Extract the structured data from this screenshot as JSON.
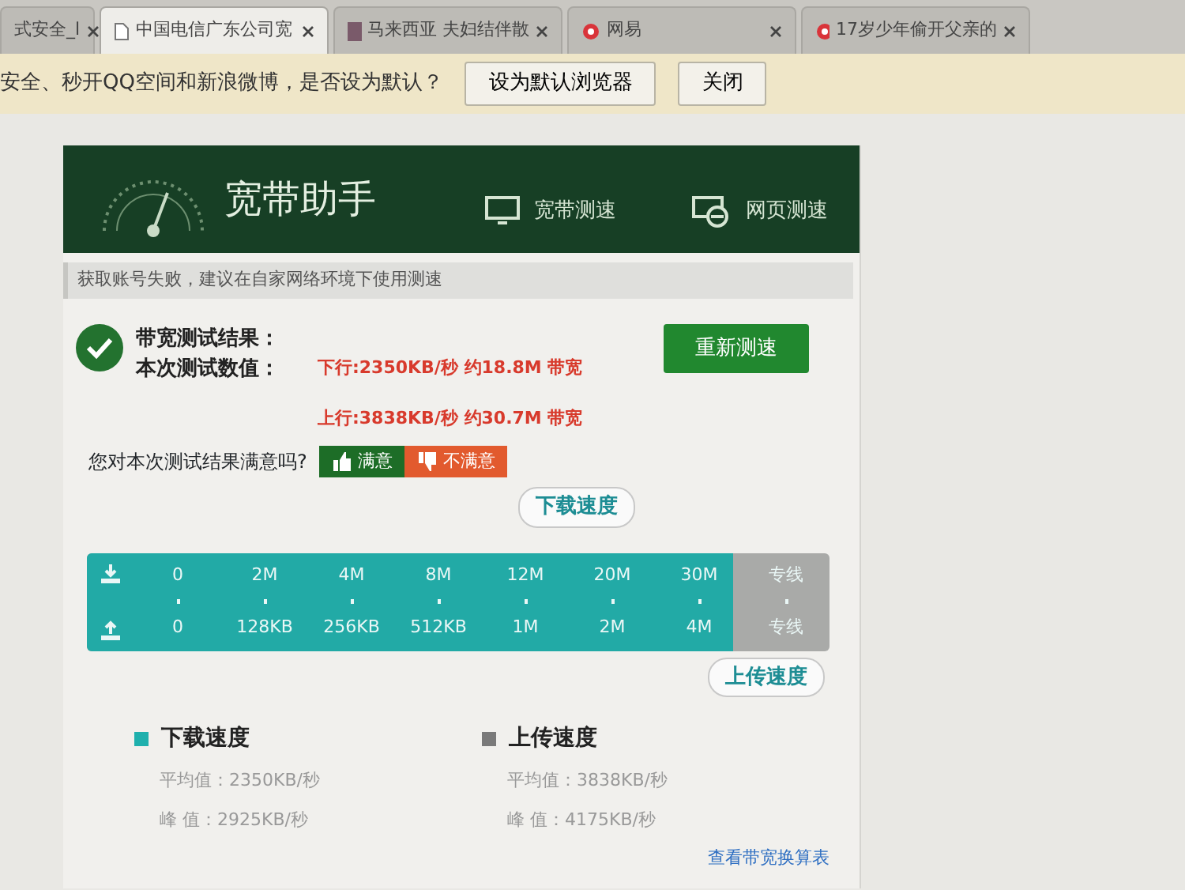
{
  "tabs": [
    {
      "label": "式安全_l",
      "selected": false,
      "kind": "plain"
    },
    {
      "label": "中国电信广东公司宽",
      "selected": true,
      "kind": "page"
    },
    {
      "label": "马来西亚 夫妇结伴散",
      "selected": false,
      "kind": "tile"
    },
    {
      "label": "网易",
      "selected": false,
      "kind": "news"
    },
    {
      "label": "17岁少年偷开父亲的",
      "selected": false,
      "kind": "news"
    }
  ],
  "infobar": {
    "message": "安全、秒开QQ空间和新浪微博，是否设为默认？",
    "buttons": [
      "设为默认浏览器",
      "关闭"
    ]
  },
  "app": {
    "title": "宽带助手",
    "nav": [
      {
        "label": "宽带测速",
        "kind": "monitor"
      },
      {
        "label": "网页测速",
        "kind": "browser"
      }
    ],
    "notice": "获取账号失败，建议在自家网络环境下使用测速",
    "result": {
      "heading": "带宽测试结果：",
      "label": "本次测试数值：",
      "download": "下行:2350KB/秒 约18.8M 带宽",
      "upload": "上行:3838KB/秒 约30.7M 带宽",
      "retest_button": "重新测速"
    },
    "feedback": {
      "question": "您对本次测试结果满意吗?",
      "buttons": [
        {
          "label": "满意",
          "kind": "good"
        },
        {
          "label": "不满意",
          "kind": "bad"
        }
      ]
    },
    "scale": {
      "download_bubble": "下载速度",
      "upload_bubble": "上传速度",
      "level": 0.87,
      "download_ticks": [
        "0",
        "2M",
        "4M",
        "8M",
        "12M",
        "20M",
        "30M",
        "专线"
      ],
      "upload_ticks": [
        "0",
        "128KB",
        "256KB",
        "512KB",
        "1M",
        "2M",
        "4M",
        "专线"
      ]
    },
    "legend": [
      {
        "title": "下载速度",
        "color": "#1fb0ad",
        "average": "平均值：2350KB/秒",
        "peak": "峰 值：2925KB/秒"
      },
      {
        "title": "上传速度",
        "color": "#7a7a7a",
        "average": "平均值：3838KB/秒",
        "peak": "峰 值：4175KB/秒"
      }
    ],
    "conversion_link": "查看带宽换算表"
  }
}
